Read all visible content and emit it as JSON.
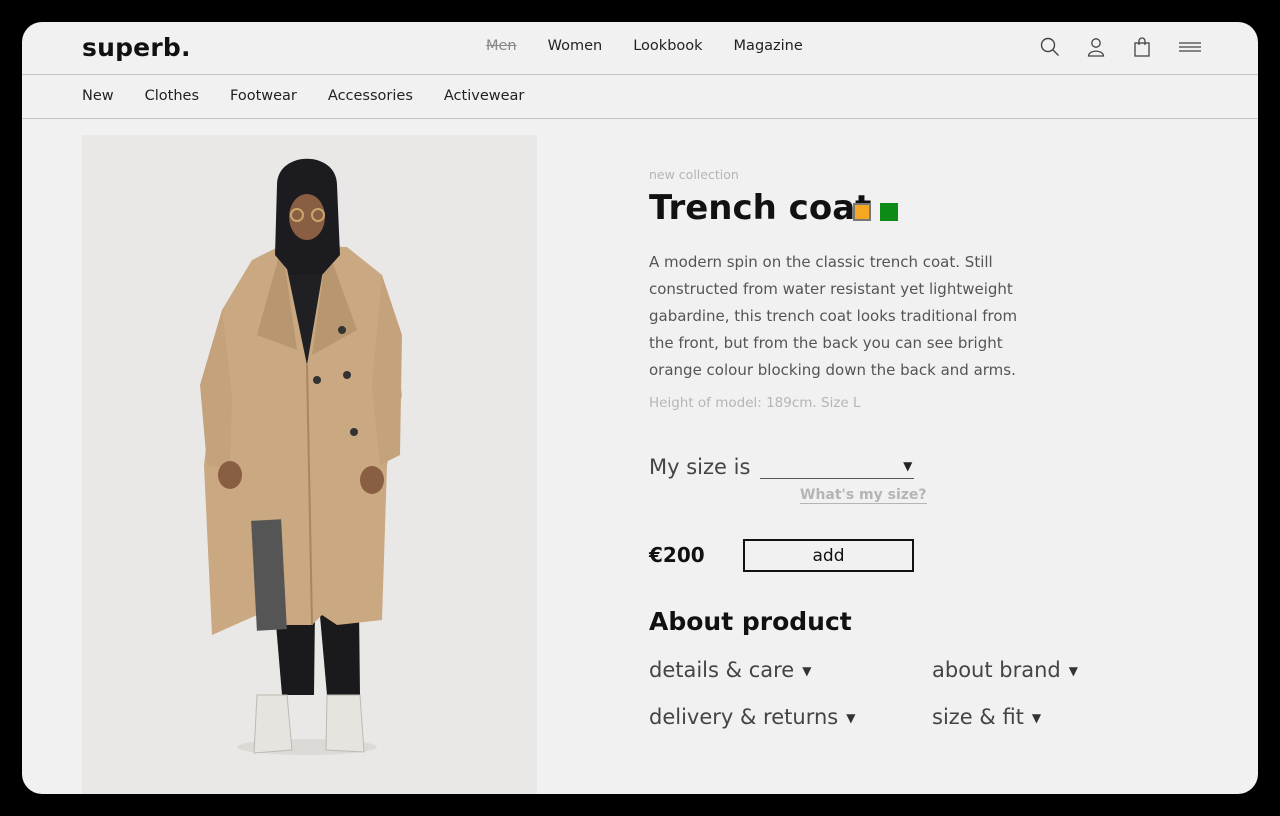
{
  "brand": {
    "logo": "superb."
  },
  "main_nav": [
    {
      "label": "Men",
      "struck": true
    },
    {
      "label": "Women",
      "struck": false
    },
    {
      "label": "Lookbook",
      "struck": false
    },
    {
      "label": "Magazine",
      "struck": false
    }
  ],
  "header_icons": [
    "search-icon",
    "account-icon",
    "bag-icon",
    "menu-icon"
  ],
  "sub_nav": [
    "New",
    "Clothes",
    "Footwear",
    "Accessories",
    "Activewear"
  ],
  "product": {
    "kicker": "new collection",
    "title": "Trench coat",
    "colors": [
      {
        "name": "orange",
        "hex": "#f5a623",
        "selected": true
      },
      {
        "name": "green",
        "hex": "#0e8a16",
        "selected": false
      }
    ],
    "description": "A modern spin on the classic trench coat. Still constructed from water resistant yet lightweight gabardine, this trench coat looks traditional from the front, but from the back you can see bright orange colour blocking down the back and arms.",
    "model_note": "Height of model: 189cm. Size L",
    "size_label": "My size is",
    "size_value": "",
    "size_help": "What's my size?",
    "price": "€200",
    "add_label": "add"
  },
  "about": {
    "heading": "About product",
    "items": [
      "details & care",
      "about brand",
      "delivery & returns",
      "size & fit"
    ]
  },
  "colors": {
    "background": "#f1f1f1",
    "text": "#111111",
    "muted": "#b5b5b5",
    "divider": "#c4c4c4"
  }
}
